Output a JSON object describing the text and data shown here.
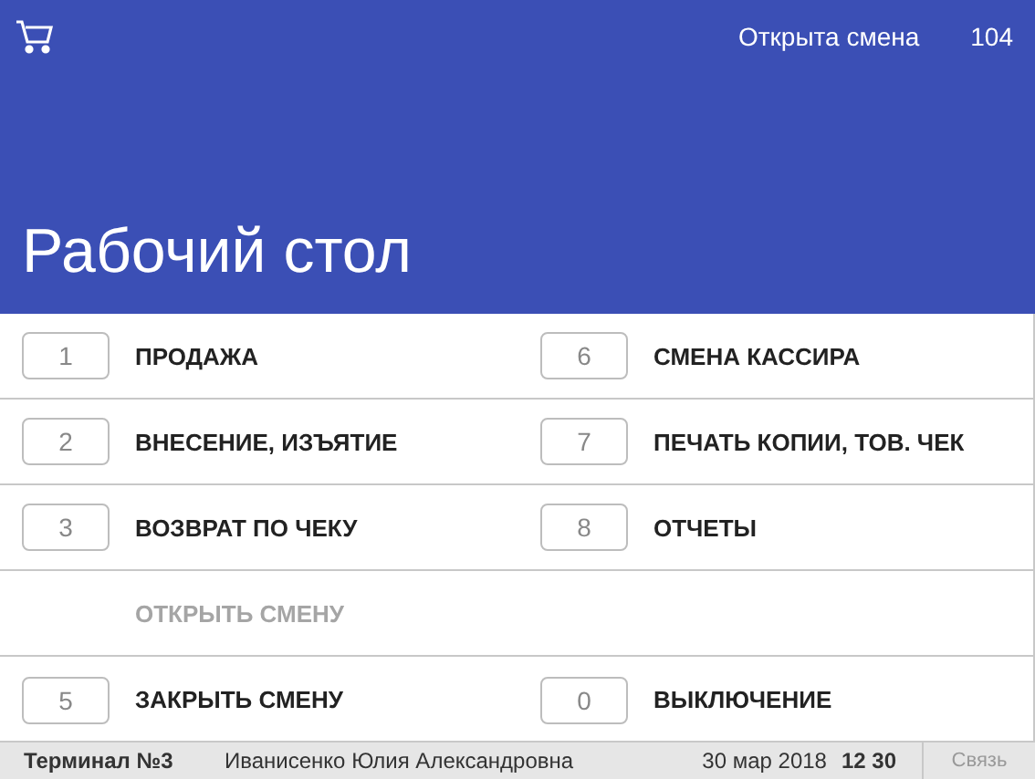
{
  "header": {
    "shift_status": "Открыта смена",
    "shift_number": "104",
    "title": "Рабочий стол"
  },
  "menu": [
    {
      "kind": "action",
      "key": "1",
      "label": "ПРОДАЖА",
      "disabled": false
    },
    {
      "kind": "action",
      "key": "6",
      "label": "СМЕНА КАССИРА",
      "disabled": false
    },
    {
      "kind": "action",
      "key": "2",
      "label": "ВНЕСЕНИЕ, ИЗЪЯТИЕ",
      "disabled": false
    },
    {
      "kind": "action",
      "key": "7",
      "label": "ПЕЧАТЬ КОПИИ, ТОВ. ЧЕК",
      "disabled": false
    },
    {
      "kind": "action",
      "key": "3",
      "label": "ВОЗВРАТ ПО ЧЕКУ",
      "disabled": false
    },
    {
      "kind": "action",
      "key": "8",
      "label": "ОТЧЕТЫ",
      "disabled": false
    },
    {
      "kind": "action",
      "label": "ОТКРЫТЬ СМЕНУ",
      "disabled": true
    },
    {
      "kind": "empty"
    },
    {
      "kind": "action",
      "key": "5",
      "label": "ЗАКРЫТЬ СМЕНУ",
      "disabled": false
    },
    {
      "kind": "action",
      "key": "0",
      "label": "ВЫКЛЮЧЕНИЕ",
      "disabled": false
    }
  ],
  "status_bar": {
    "terminal": "Терминал №3",
    "cashier": "Иванисенко Юлия Александровна",
    "date": "30 мар 2018",
    "time": "12 30",
    "connection": "Связь"
  }
}
